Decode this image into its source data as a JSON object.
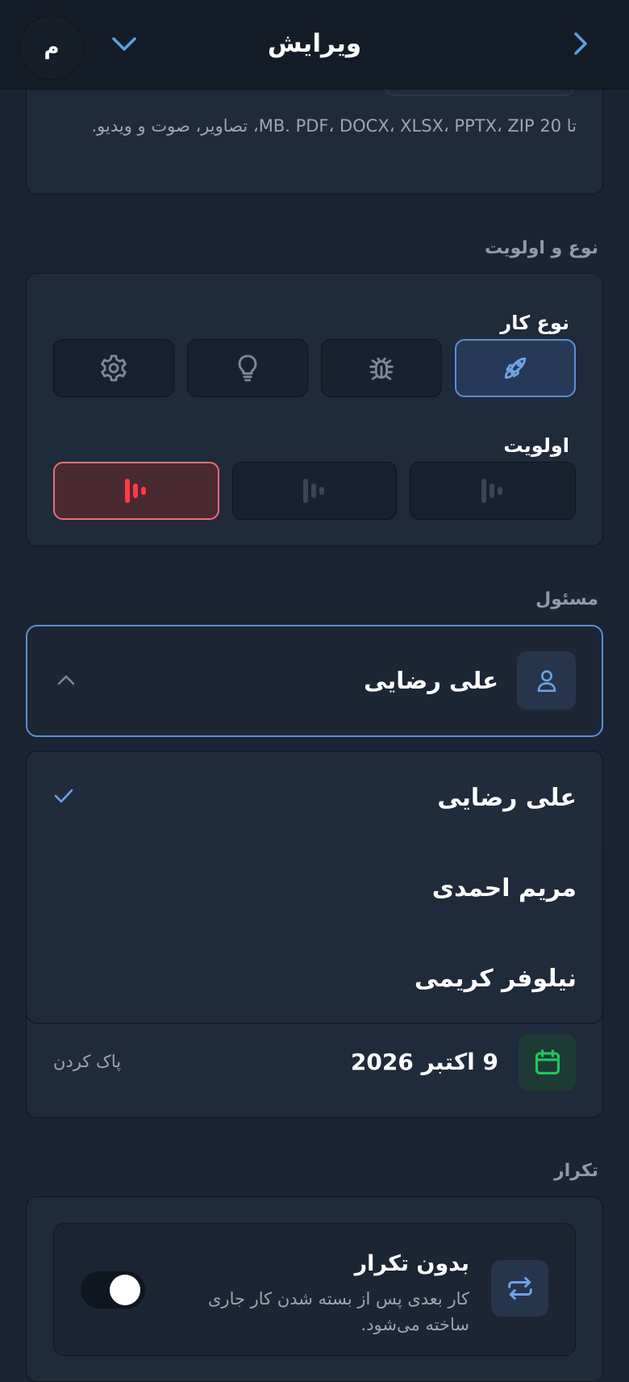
{
  "header": {
    "title": "ویرایش",
    "avatar_initial": "م"
  },
  "attachments": {
    "help_text": "تا 20 MB. PDF، DOCX، XLSX، PPTX، ZIP، تصاویر، صوت و ویدیو."
  },
  "type_priority": {
    "section_title": "نوع و اولویت",
    "type_label": "نوع کار",
    "types": [
      {
        "icon": "rocket-icon",
        "selected": true
      },
      {
        "icon": "bug-icon",
        "selected": false
      },
      {
        "icon": "lightbulb-icon",
        "selected": false
      },
      {
        "icon": "gear-icon",
        "selected": false
      }
    ],
    "priority_label": "اولویت",
    "priorities": [
      {
        "icon": "priority-low-icon",
        "selected": false
      },
      {
        "icon": "priority-medium-icon",
        "selected": false
      },
      {
        "icon": "priority-high-icon",
        "selected": true,
        "color": "#ff3b47"
      }
    ]
  },
  "assignee": {
    "section_title": "مسئول",
    "selected_name": "علی رضایی",
    "options": [
      {
        "name": "علی رضایی",
        "selected": true
      },
      {
        "name": "مریم احمدی",
        "selected": false
      },
      {
        "name": "نیلوفر کریمی",
        "selected": false
      }
    ]
  },
  "due_date": {
    "value": "9 اکتبر 2026",
    "clear_label": "پاک کردن",
    "icon": "calendar-icon",
    "accent": "#22c55e"
  },
  "repeat": {
    "section_title": "تکرار",
    "title": "بدون تکرار",
    "description": "کار بعدی پس از بسته شدن کار جاری ساخته می‌شود.",
    "icon": "repeat-icon",
    "enabled": false
  },
  "colors": {
    "accent_blue": "#5a8fd0",
    "danger": "#ef6b75",
    "background": "#1a2433"
  }
}
